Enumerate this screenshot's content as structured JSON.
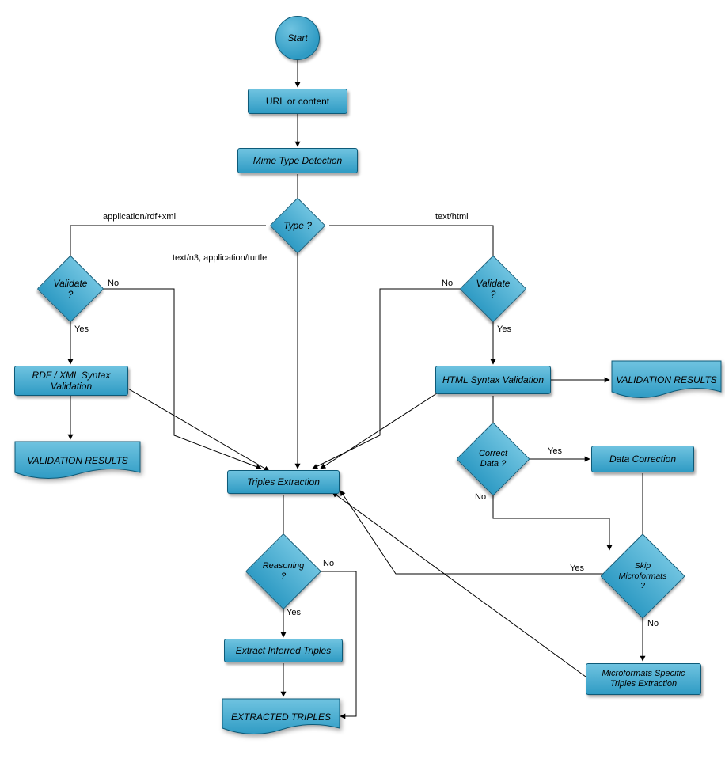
{
  "nodes": {
    "start": "Start",
    "urlContent": "URL or content",
    "mimeDetect": "Mime Type Detection",
    "type": "Type ?",
    "validateLeft": "Validate ?",
    "validateRight": "Validate ?",
    "rdfXmlValidation": "RDF / XML Syntax Validation",
    "htmlValidation": "HTML Syntax Validation",
    "validationResults1": "VALIDATION RESULTS",
    "validationResults2": "VALIDATION RESULTS",
    "correctData": "Correct Data ?",
    "dataCorrection": "Data Correction",
    "skipMicroformats": "Skip Microformats ?",
    "mfExtraction": "Microformats Specific Triples Extraction",
    "triplesExtraction": "Triples Extraction",
    "reasoning": "Reasoning ?",
    "inferred": "Extract Inferred Triples",
    "extracted": "EXTRACTED TRIPLES"
  },
  "edgeLabels": {
    "appRdfXml": "application/rdf+xml",
    "textN3": "text/n3, application/turtle",
    "textHtml": "text/html",
    "yes": "Yes",
    "no": "No"
  },
  "colors": {
    "nodeFill1": "#6fc3e0",
    "nodeFill2": "#2f9bc4",
    "nodeBorder": "#0d5a78",
    "arrow": "#000000"
  },
  "chart_data": {
    "type": "flowchart",
    "title": "",
    "nodes": [
      {
        "id": "start",
        "label": "Start",
        "shape": "circle"
      },
      {
        "id": "urlContent",
        "label": "URL or content",
        "shape": "process"
      },
      {
        "id": "mimeDetect",
        "label": "Mime Type Detection",
        "shape": "process"
      },
      {
        "id": "type",
        "label": "Type ?",
        "shape": "decision"
      },
      {
        "id": "validateLeft",
        "label": "Validate ?",
        "shape": "decision"
      },
      {
        "id": "validateRight",
        "label": "Validate ?",
        "shape": "decision"
      },
      {
        "id": "rdfXmlValidation",
        "label": "RDF / XML Syntax Validation",
        "shape": "process"
      },
      {
        "id": "htmlValidation",
        "label": "HTML Syntax Validation",
        "shape": "process"
      },
      {
        "id": "validationResults1",
        "label": "VALIDATION RESULTS",
        "shape": "document"
      },
      {
        "id": "validationResults2",
        "label": "VALIDATION RESULTS",
        "shape": "document"
      },
      {
        "id": "correctData",
        "label": "Correct Data ?",
        "shape": "decision"
      },
      {
        "id": "dataCorrection",
        "label": "Data Correction",
        "shape": "process"
      },
      {
        "id": "skipMicroformats",
        "label": "Skip Microformats ?",
        "shape": "decision"
      },
      {
        "id": "mfExtraction",
        "label": "Microformats Specific Triples Extraction",
        "shape": "process"
      },
      {
        "id": "triplesExtraction",
        "label": "Triples Extraction",
        "shape": "process"
      },
      {
        "id": "reasoning",
        "label": "Reasoning ?",
        "shape": "decision"
      },
      {
        "id": "inferred",
        "label": "Extract Inferred Triples",
        "shape": "process"
      },
      {
        "id": "extracted",
        "label": "EXTRACTED TRIPLES",
        "shape": "document"
      }
    ],
    "edges": [
      {
        "from": "start",
        "to": "urlContent",
        "label": ""
      },
      {
        "from": "urlContent",
        "to": "mimeDetect",
        "label": ""
      },
      {
        "from": "mimeDetect",
        "to": "type",
        "label": ""
      },
      {
        "from": "type",
        "to": "validateLeft",
        "label": "application/rdf+xml"
      },
      {
        "from": "type",
        "to": "triplesExtraction",
        "label": "text/n3, application/turtle"
      },
      {
        "from": "type",
        "to": "validateRight",
        "label": "text/html"
      },
      {
        "from": "validateLeft",
        "to": "rdfXmlValidation",
        "label": "Yes"
      },
      {
        "from": "validateLeft",
        "to": "triplesExtraction",
        "label": "No"
      },
      {
        "from": "rdfXmlValidation",
        "to": "validationResults1",
        "label": ""
      },
      {
        "from": "rdfXmlValidation",
        "to": "triplesExtraction",
        "label": ""
      },
      {
        "from": "validateRight",
        "to": "htmlValidation",
        "label": "Yes"
      },
      {
        "from": "validateRight",
        "to": "triplesExtraction",
        "label": "No"
      },
      {
        "from": "htmlValidation",
        "to": "validationResults2",
        "label": ""
      },
      {
        "from": "htmlValidation",
        "to": "triplesExtraction",
        "label": ""
      },
      {
        "from": "htmlValidation",
        "to": "correctData",
        "label": ""
      },
      {
        "from": "correctData",
        "to": "dataCorrection",
        "label": "Yes"
      },
      {
        "from": "correctData",
        "to": "skipMicroformats",
        "label": "No"
      },
      {
        "from": "dataCorrection",
        "to": "skipMicroformats",
        "label": ""
      },
      {
        "from": "skipMicroformats",
        "to": "triplesExtraction",
        "label": "Yes"
      },
      {
        "from": "skipMicroformats",
        "to": "mfExtraction",
        "label": "No"
      },
      {
        "from": "mfExtraction",
        "to": "triplesExtraction",
        "label": ""
      },
      {
        "from": "triplesExtraction",
        "to": "reasoning",
        "label": ""
      },
      {
        "from": "reasoning",
        "to": "inferred",
        "label": "Yes"
      },
      {
        "from": "reasoning",
        "to": "extracted",
        "label": "No"
      },
      {
        "from": "inferred",
        "to": "extracted",
        "label": ""
      }
    ]
  }
}
